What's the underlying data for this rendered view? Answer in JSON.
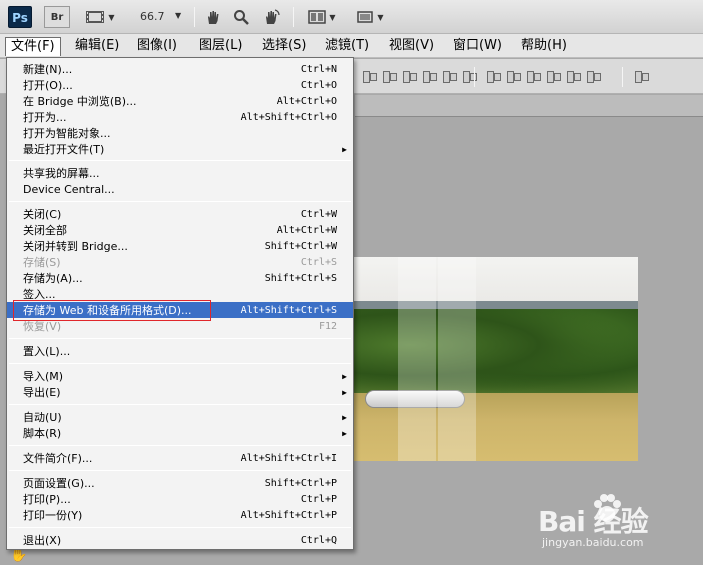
{
  "appbar": {
    "logo": "Ps",
    "bridge": "Br",
    "zoom": "66.7"
  },
  "menubar": [
    {
      "label": "文件(F)"
    },
    {
      "label": "编辑(E)"
    },
    {
      "label": "图像(I)"
    },
    {
      "label": "图层(L)"
    },
    {
      "label": "选择(S)"
    },
    {
      "label": "滤镜(T)"
    },
    {
      "label": "视图(V)"
    },
    {
      "label": "窗口(W)"
    },
    {
      "label": "帮助(H)"
    }
  ],
  "file_menu": [
    {
      "label": "新建(N)...",
      "shortcut": "Ctrl+N"
    },
    {
      "label": "打开(O)...",
      "shortcut": "Ctrl+O"
    },
    {
      "label": "在 Bridge 中浏览(B)...",
      "shortcut": "Alt+Ctrl+O"
    },
    {
      "label": "打开为...",
      "shortcut": "Alt+Shift+Ctrl+O"
    },
    {
      "label": "打开为智能对象..."
    },
    {
      "label": "最近打开文件(T)"
    },
    {
      "label": "共享我的屏幕..."
    },
    {
      "label": "Device Central..."
    },
    {
      "label": "关闭(C)",
      "shortcut": "Ctrl+W"
    },
    {
      "label": "关闭全部",
      "shortcut": "Alt+Ctrl+W"
    },
    {
      "label": "关闭并转到 Bridge...",
      "shortcut": "Shift+Ctrl+W"
    },
    {
      "label": "存储(S)",
      "shortcut": "Ctrl+S"
    },
    {
      "label": "存储为(A)...",
      "shortcut": "Shift+Ctrl+S"
    },
    {
      "label": "签入..."
    },
    {
      "label": "存储为 Web 和设备所用格式(D)...",
      "shortcut": "Alt+Shift+Ctrl+S"
    },
    {
      "label": "恢复(V)",
      "shortcut": "F12"
    },
    {
      "label": "置入(L)..."
    },
    {
      "label": "导入(M)"
    },
    {
      "label": "导出(E)"
    },
    {
      "label": "自动(U)"
    },
    {
      "label": "脚本(R)"
    },
    {
      "label": "文件简介(F)...",
      "shortcut": "Alt+Shift+Ctrl+I"
    },
    {
      "label": "页面设置(G)...",
      "shortcut": "Shift+Ctrl+P"
    },
    {
      "label": "打印(P)...",
      "shortcut": "Ctrl+P"
    },
    {
      "label": "打印一份(Y)",
      "shortcut": "Alt+Shift+Ctrl+P"
    },
    {
      "label": "退出(X)",
      "shortcut": "Ctrl+Q"
    }
  ],
  "watermark": {
    "brand": "Bai  经验",
    "url": "jingyan.baidu.com"
  },
  "colors": {
    "highlight": "#3b6fc6",
    "annotation": "#e0262b"
  }
}
